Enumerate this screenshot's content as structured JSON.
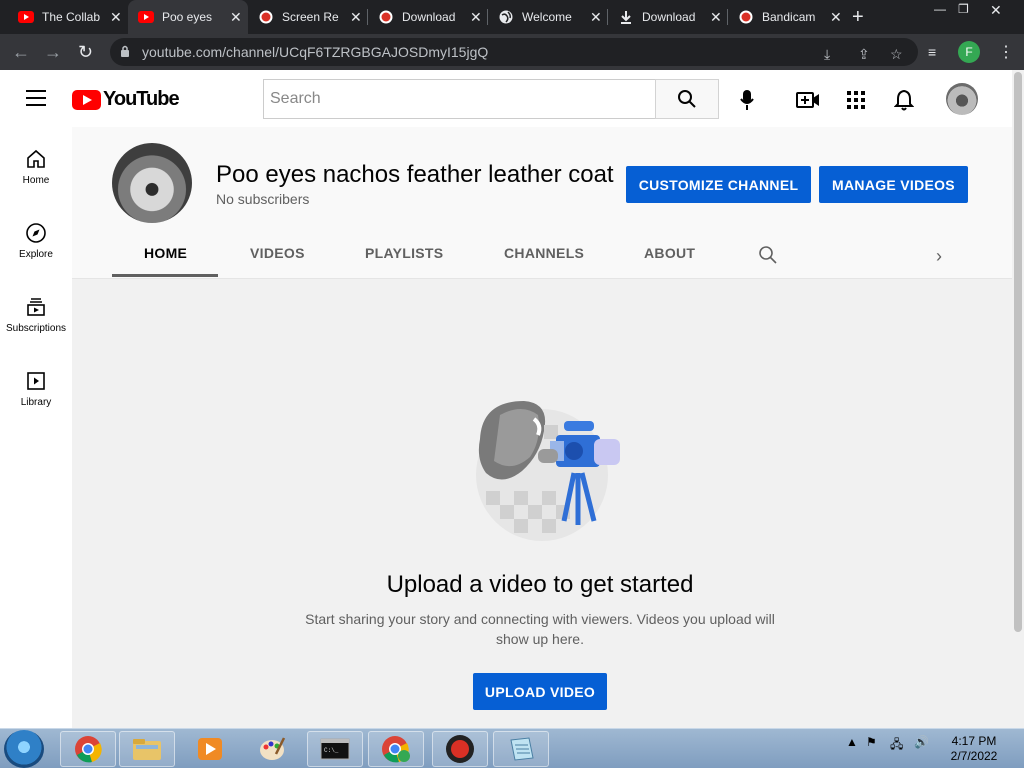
{
  "browser": {
    "tabs": [
      {
        "title": "The Collab",
        "favicon": "youtube-icon"
      },
      {
        "title": "Poo eyes",
        "favicon": "youtube-icon"
      },
      {
        "title": "Screen Re",
        "favicon": "record-icon"
      },
      {
        "title": "Download",
        "favicon": "record-icon"
      },
      {
        "title": "Welcome",
        "favicon": "globe-icon"
      },
      {
        "title": "Download",
        "favicon": "download-icon"
      },
      {
        "title": "Bandicam",
        "favicon": "record-icon"
      }
    ],
    "url": "youtube.com/channel/UCqF6TZRGBGAJOSDmyI15jgQ",
    "profile_initial": "F"
  },
  "youtube": {
    "logo_text": "YouTube",
    "search_placeholder": "Search",
    "sidebar": [
      {
        "label": "Home",
        "icon": "home-icon"
      },
      {
        "label": "Explore",
        "icon": "compass-icon"
      },
      {
        "label": "Subscriptions",
        "icon": "subscriptions-icon"
      },
      {
        "label": "Library",
        "icon": "library-icon"
      }
    ],
    "channel": {
      "name": "Poo eyes nachos feather leather coat",
      "subscribers": "No subscribers",
      "customize_label": "CUSTOMIZE CHANNEL",
      "manage_label": "MANAGE VIDEOS",
      "tabs": [
        "HOME",
        "VIDEOS",
        "PLAYLISTS",
        "CHANNELS",
        "ABOUT"
      ],
      "active_tab": "HOME"
    },
    "empty_state": {
      "title": "Upload a video to get started",
      "description": "Start sharing your story and connecting with viewers. Videos you upload will show up here.",
      "button_label": "UPLOAD VIDEO"
    },
    "accent_color": "#065fd4"
  },
  "taskbar": {
    "time": "4:17 PM",
    "date": "2/7/2022"
  }
}
